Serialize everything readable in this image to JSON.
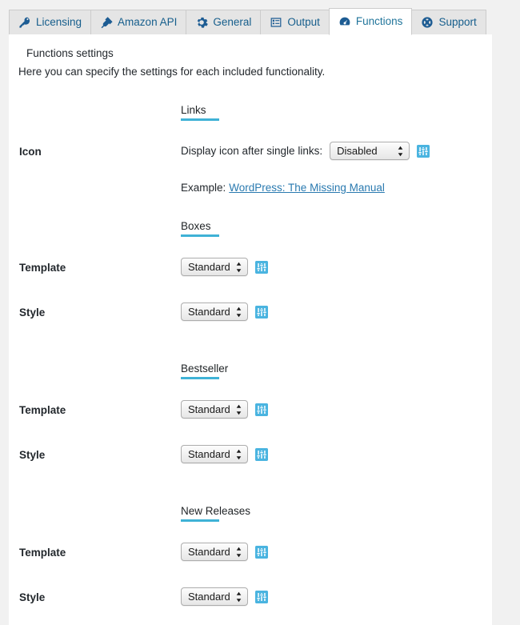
{
  "tabs": [
    {
      "label": "Licensing",
      "icon": "key-icon",
      "active": false
    },
    {
      "label": "Amazon API",
      "icon": "plug-icon",
      "active": false
    },
    {
      "label": "General",
      "icon": "gear-icon",
      "active": false
    },
    {
      "label": "Output",
      "icon": "list-view-icon",
      "active": false
    },
    {
      "label": "Functions",
      "icon": "dashboard-icon",
      "active": true
    },
    {
      "label": "Support",
      "icon": "lifebuoy-icon",
      "active": false
    }
  ],
  "page": {
    "title": "Functions settings",
    "description": "Here you can specify the settings for each included functionality."
  },
  "sections": [
    {
      "heading": "Links",
      "rows": [
        {
          "label": "Icon",
          "inline_label": "Display icon after single links:",
          "select_value": "Disabled",
          "select_width": "wide",
          "helper_icon": "sliders-icon"
        }
      ],
      "example": {
        "prefix": "Example:",
        "link_text": "WordPress: The Missing Manual"
      }
    },
    {
      "heading": "Boxes",
      "rows": [
        {
          "label": "Template",
          "inline_label": "",
          "select_value": "Standard",
          "select_width": "narrow",
          "helper_icon": "sliders-icon"
        },
        {
          "label": "Style",
          "inline_label": "",
          "select_value": "Standard",
          "select_width": "narrow",
          "helper_icon": "sliders-icon"
        }
      ]
    },
    {
      "heading": "Bestseller",
      "rows": [
        {
          "label": "Template",
          "inline_label": "",
          "select_value": "Standard",
          "select_width": "narrow",
          "helper_icon": "sliders-icon"
        },
        {
          "label": "Style",
          "inline_label": "",
          "select_value": "Standard",
          "select_width": "narrow",
          "helper_icon": "sliders-icon"
        }
      ]
    },
    {
      "heading": "New Releases",
      "rows": [
        {
          "label": "Template",
          "inline_label": "",
          "select_value": "Standard",
          "select_width": "narrow",
          "helper_icon": "sliders-icon"
        },
        {
          "label": "Style",
          "inline_label": "",
          "select_value": "Standard",
          "select_width": "narrow",
          "helper_icon": "sliders-icon"
        }
      ]
    }
  ],
  "colors": {
    "accent_underline": "#3fb2d6",
    "tab_link": "#21759b",
    "helper_icon_bg": "#4ab4e0",
    "link": "#2a7ab0",
    "page_bg": "#f1f1f1"
  }
}
